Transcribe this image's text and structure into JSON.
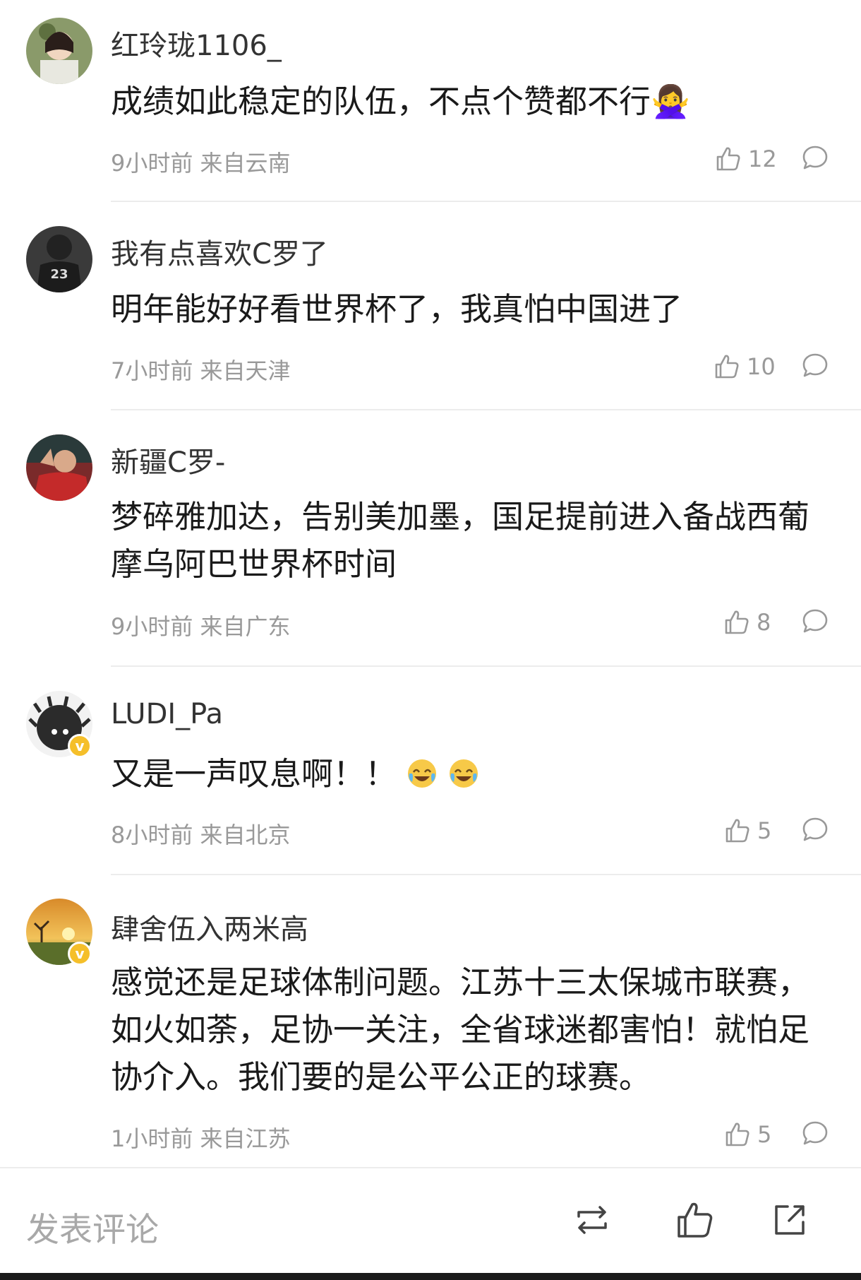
{
  "comments": [
    {
      "username": "红玲珑1106_",
      "content": "成绩如此稳定的队伍，不点个赞都不行🙅‍♀️",
      "time": "9小时前",
      "location": "来自云南",
      "likes": "12"
    },
    {
      "username": "我有点喜欢C罗了",
      "content": "明年能好好看世界杯了，我真怕中国进了",
      "time": "7小时前",
      "location": "来自天津",
      "likes": "10"
    },
    {
      "username": "新疆C罗-",
      "content": "梦碎雅加达，告别美加墨，国足提前进入备战西葡摩乌阿巴世界杯时间",
      "time": "9小时前",
      "location": "来自广东",
      "likes": "8"
    },
    {
      "username": "LUDI_Pa",
      "content": "又是一声叹息啊！！",
      "time": "8小时前",
      "location": "来自北京",
      "likes": "5"
    },
    {
      "username": "肆舍伍入两米高",
      "content": "感觉还是足球体制问题。江苏十三太保城市联赛，如火如荼，足协一关注，全省球迷都害怕！就怕足协介入。我们要的是公平公正的球赛。",
      "time": "1小时前",
      "location": "来自江苏",
      "likes": "5"
    }
  ],
  "bottom_bar": {
    "input_placeholder": "发表评论"
  },
  "colors": {
    "meta_gray": "#999999",
    "badge_gold": "#f5bf2a",
    "divider": "#ececec"
  }
}
